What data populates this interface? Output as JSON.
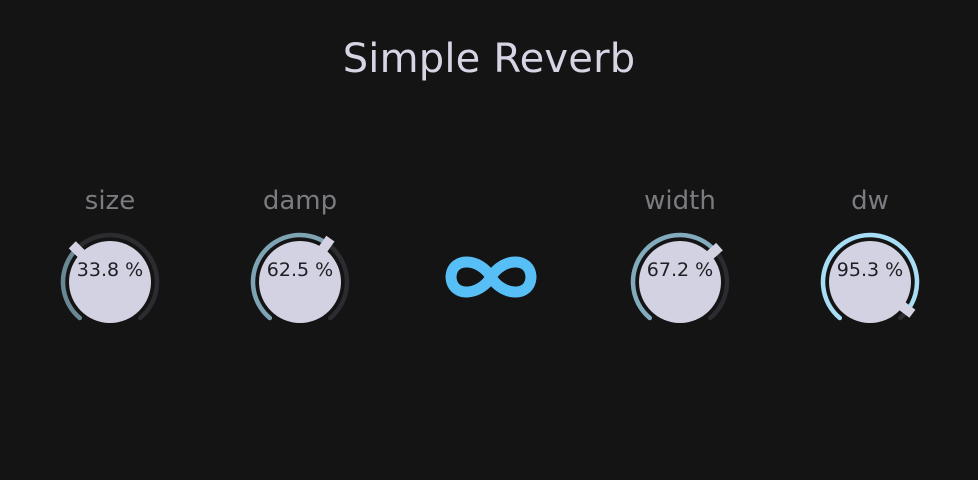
{
  "header": {
    "title": "Simple Reverb"
  },
  "knobs": [
    {
      "id": "size",
      "label": "size",
      "value_text": "33.8 %",
      "value": 0.338,
      "arc_color": "#6a8794"
    },
    {
      "id": "damp",
      "label": "damp",
      "value_text": "62.5 %",
      "value": 0.625,
      "arc_color": "#7ea4b4"
    },
    {
      "id": "width",
      "label": "width",
      "value_text": "67.2 %",
      "value": 0.672,
      "arc_color": "#82abbd"
    },
    {
      "id": "dw",
      "label": "dw",
      "value_text": "95.3 %",
      "value": 0.953,
      "arc_color": "#a8def5"
    }
  ],
  "center_icon": {
    "name": "infinity-icon",
    "color": "#57bff5"
  },
  "colors": {
    "background": "#141415",
    "knob_face": "#d3d2e2",
    "track": "#2c2c30",
    "indicator": "#d3d2e2"
  }
}
